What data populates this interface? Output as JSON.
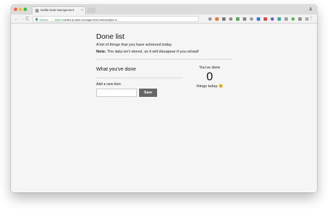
{
  "browser": {
    "tab_title": "Vanilla State Management",
    "tab_close": "×",
    "secure_label": "Secure",
    "separator": "|",
    "url_scheme": "https://",
    "url_rest": "vanilla-js-state-management.hankchizljaw.io",
    "back_glyph": "←",
    "forward_glyph": "→",
    "reload_glyph": "C",
    "menu_glyph": "⋮",
    "profile_glyph": "♟",
    "extension_icons": [
      {
        "name": "star-icon",
        "color": "#9a9a9a"
      },
      {
        "name": "extension-orange-icon",
        "color": "#e87a3c"
      },
      {
        "name": "extension-gray-icon",
        "color": "#7b7b7b"
      },
      {
        "name": "extension-p-icon",
        "color": "#8c8c8c"
      },
      {
        "name": "extension-green-icon",
        "color": "#5aa35a"
      },
      {
        "name": "extension-gray2-icon",
        "color": "#8a8a8a"
      },
      {
        "name": "extension-gray3-icon",
        "color": "#9d9d9d"
      },
      {
        "name": "extension-blue-icon",
        "color": "#3a7bd5"
      },
      {
        "name": "extension-red-icon",
        "color": "#d84c3c"
      },
      {
        "name": "extension-purple-icon",
        "color": "#7b5fc7"
      },
      {
        "name": "extension-teal-icon",
        "color": "#3ca9a3"
      },
      {
        "name": "extension-gray4-icon",
        "color": "#a0a0a0"
      },
      {
        "name": "extension-green2-icon",
        "color": "#5dbb63"
      },
      {
        "name": "extension-gray5-icon",
        "color": "#8f8f8f"
      },
      {
        "name": "extension-gray6-icon",
        "color": "#b0b0b0"
      }
    ]
  },
  "page": {
    "title": "Done list",
    "subtitle": "A list of things that you have achieved today.",
    "note_label": "Note:",
    "note_text": " The data isn't stored, so it will dissapear if you reload!",
    "section_heading": "What you've done",
    "add_label": "Add a new item",
    "input_value": "",
    "save_label": "Save",
    "stats_top": "You've done",
    "stats_count": "0",
    "stats_bottom": "things today"
  },
  "colors": {
    "secure_green": "#168c3c",
    "button_bg": "#666666",
    "page_bg": "#f5f5f5"
  }
}
